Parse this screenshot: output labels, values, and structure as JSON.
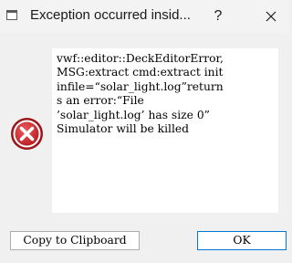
{
  "window": {
    "title": "Exception occurred insid...",
    "help_label": "?",
    "close_icon": "close-icon",
    "app_icon": "window-icon"
  },
  "message": {
    "icon": "error-icon",
    "lines": [
      "vwf::editor::DeckEditorError,",
      "MSG:extract cmd:extract init",
      "infile=“solar_light.log”return",
      "s an error:“File",
      "’solar_light.log’ has size 0”",
      "Simulator will be killed"
    ]
  },
  "buttons": {
    "copy_label": "Copy to Clipboard",
    "ok_label": "OK"
  },
  "colors": {
    "error_red": "#d0282c",
    "ok_border": "#0078d7",
    "window_bg": "#f0f0f0"
  }
}
